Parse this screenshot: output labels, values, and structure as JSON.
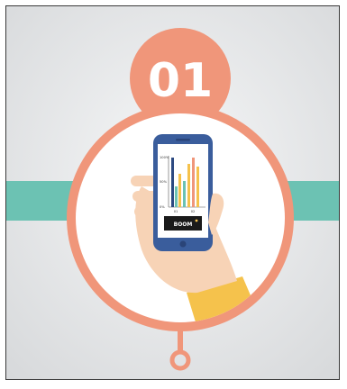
{
  "badge": {
    "number": "01"
  },
  "phone": {
    "chart": {
      "y_ticks": [
        "100%",
        "50%",
        "0%"
      ],
      "x_ticks": [
        "01",
        "02"
      ]
    },
    "button_label": "BOOM"
  },
  "colors": {
    "accent": "#f0967a",
    "teal_band": "#6cc2b3",
    "phone_body": "#3a5d9c",
    "sleeve": "#f5c24c",
    "background": "#e8e9eb"
  }
}
